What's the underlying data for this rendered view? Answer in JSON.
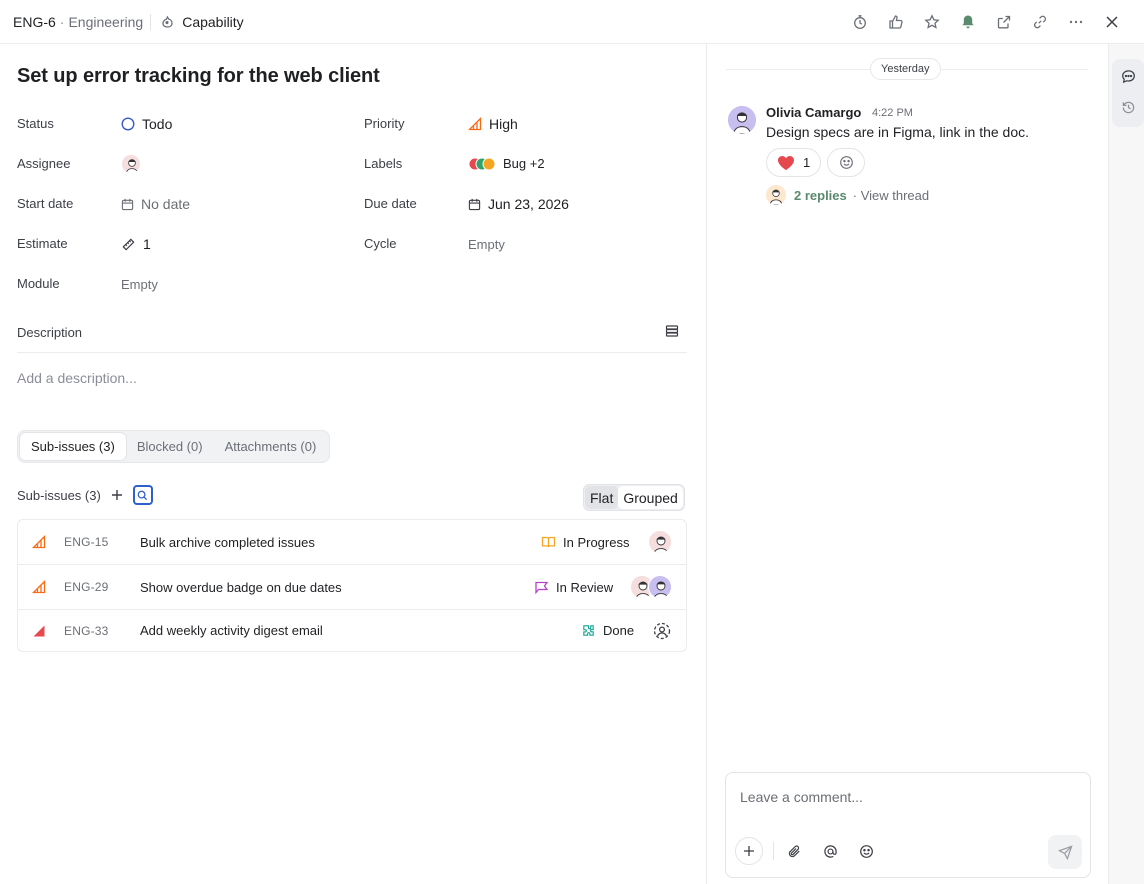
{
  "breadcrumb": {
    "id": "ENG-6",
    "separator": "·",
    "team": "Engineering",
    "project": "Capability"
  },
  "top_actions": [
    "timer-icon",
    "thumbs-up-icon",
    "star-icon",
    "bell-icon",
    "open-external-icon",
    "link-icon",
    "more-icon",
    "close-icon"
  ],
  "issue": {
    "title": "Set up error tracking for the web client",
    "properties": {
      "status_label": "Status",
      "status_value": "Todo",
      "priority_label": "Priority",
      "priority_value": "High",
      "assignee_label": "Assignee",
      "labels_label": "Labels",
      "labels_value": "Bug +2",
      "start_label": "Start date",
      "start_value": "No date",
      "due_label": "Due date",
      "due_value": "Jun 23, 2026",
      "estimate_label": "Estimate",
      "estimate_value": "1",
      "cycle_label": "Cycle",
      "cycle_value": "Empty",
      "module_label": "Module",
      "module_value": "Empty"
    },
    "label_colors": [
      "#e5484d",
      "#30a46c",
      "#f5a524"
    ],
    "description_label": "Description",
    "description_placeholder": "Add a description..."
  },
  "tabs": [
    {
      "label": "Sub-issues (3)",
      "active": true
    },
    {
      "label": "Blocked (0)",
      "active": false
    },
    {
      "label": "Attachments (0)",
      "active": false
    }
  ],
  "sub_issues": {
    "header": "Sub-issues (3)",
    "view_flat": "Flat",
    "view_grouped": "Grouped",
    "rows": [
      {
        "id": "ENG-15",
        "title": "Bulk archive completed issues",
        "status": "In Progress",
        "priority": "high"
      },
      {
        "id": "ENG-29",
        "title": "Show overdue badge on due dates",
        "status": "In Review",
        "priority": "high"
      },
      {
        "id": "ENG-33",
        "title": "Add weekly activity digest email",
        "status": "Done",
        "priority": "urgent"
      }
    ]
  },
  "activity": {
    "day_label": "Yesterday",
    "comment": {
      "author": "Olivia Camargo",
      "time": "4:22 PM",
      "body": "Design specs are in Figma, link in the doc.",
      "reaction_count": "1",
      "replies": "2 replies",
      "view_thread": "· View thread"
    },
    "composer_placeholder": "Leave a comment..."
  },
  "colors": {
    "priority_high": "#f76b15",
    "priority_urgent": "#e5484d",
    "in_progress": "#f5a524",
    "in_review": "#b542c8",
    "done": "#12a594",
    "replies": "#5b8a6e"
  }
}
